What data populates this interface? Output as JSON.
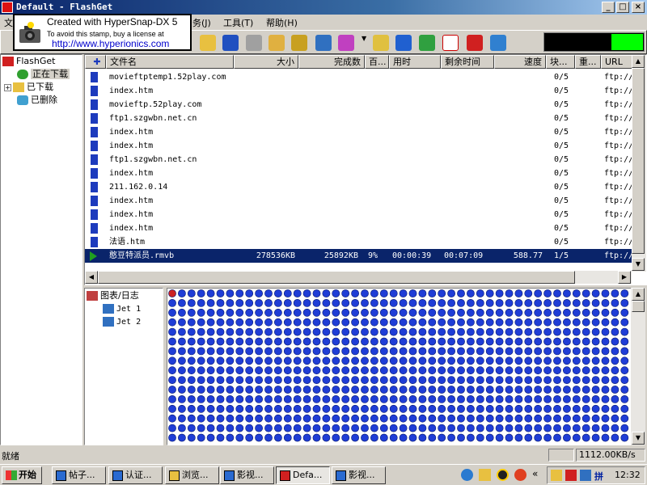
{
  "window": {
    "title": "Default - FlashGet"
  },
  "menu": {
    "visible_tail": "务(J)",
    "tools": "工具(T)",
    "help": "帮助(H)",
    "left_fragment": "文"
  },
  "stamp": {
    "line1": "Created with HyperSnap-DX 5",
    "line2": "To avoid this stamp, buy a license at",
    "line3": "http://www.hyperionics.com"
  },
  "tree": {
    "root": "FlashGet",
    "items": [
      {
        "label": "正在下载",
        "selected": true
      },
      {
        "label": "已下载",
        "selected": false
      },
      {
        "label": "已删除",
        "selected": false
      }
    ]
  },
  "list": {
    "columns": [
      "文件名",
      "大小",
      "完成数",
      "百...",
      "用时",
      "剩余时间",
      "速度",
      "块...",
      "重...",
      "URL"
    ],
    "rows": [
      {
        "name": "movieftptemp1.52play.com",
        "size": "",
        "done": "",
        "pct": "",
        "elapsed": "",
        "remaining": "",
        "speed": "",
        "blocks": "0/5",
        "retry": "",
        "url": "ftp://",
        "selected": false
      },
      {
        "name": "index.htm",
        "size": "",
        "done": "",
        "pct": "",
        "elapsed": "",
        "remaining": "",
        "speed": "",
        "blocks": "0/5",
        "retry": "",
        "url": "ftp://",
        "selected": false
      },
      {
        "name": "movieftp.52play.com",
        "size": "",
        "done": "",
        "pct": "",
        "elapsed": "",
        "remaining": "",
        "speed": "",
        "blocks": "0/5",
        "retry": "",
        "url": "ftp://",
        "selected": false
      },
      {
        "name": "ftp1.szgwbn.net.cn",
        "size": "",
        "done": "",
        "pct": "",
        "elapsed": "",
        "remaining": "",
        "speed": "",
        "blocks": "0/5",
        "retry": "",
        "url": "ftp://",
        "selected": false
      },
      {
        "name": "index.htm",
        "size": "",
        "done": "",
        "pct": "",
        "elapsed": "",
        "remaining": "",
        "speed": "",
        "blocks": "0/5",
        "retry": "",
        "url": "ftp://",
        "selected": false
      },
      {
        "name": "index.htm",
        "size": "",
        "done": "",
        "pct": "",
        "elapsed": "",
        "remaining": "",
        "speed": "",
        "blocks": "0/5",
        "retry": "",
        "url": "ftp://",
        "selected": false
      },
      {
        "name": "ftp1.szgwbn.net.cn",
        "size": "",
        "done": "",
        "pct": "",
        "elapsed": "",
        "remaining": "",
        "speed": "",
        "blocks": "0/5",
        "retry": "",
        "url": "ftp://",
        "selected": false
      },
      {
        "name": "index.htm",
        "size": "",
        "done": "",
        "pct": "",
        "elapsed": "",
        "remaining": "",
        "speed": "",
        "blocks": "0/5",
        "retry": "",
        "url": "ftp://",
        "selected": false
      },
      {
        "name": "211.162.0.14",
        "size": "",
        "done": "",
        "pct": "",
        "elapsed": "",
        "remaining": "",
        "speed": "",
        "blocks": "0/5",
        "retry": "",
        "url": "ftp://",
        "selected": false
      },
      {
        "name": "index.htm",
        "size": "",
        "done": "",
        "pct": "",
        "elapsed": "",
        "remaining": "",
        "speed": "",
        "blocks": "0/5",
        "retry": "",
        "url": "ftp://",
        "selected": false
      },
      {
        "name": "index.htm",
        "size": "",
        "done": "",
        "pct": "",
        "elapsed": "",
        "remaining": "",
        "speed": "",
        "blocks": "0/5",
        "retry": "",
        "url": "ftp://",
        "selected": false
      },
      {
        "name": "index.htm",
        "size": "",
        "done": "",
        "pct": "",
        "elapsed": "",
        "remaining": "",
        "speed": "",
        "blocks": "0/5",
        "retry": "",
        "url": "ftp://",
        "selected": false
      },
      {
        "name": "法语.htm",
        "size": "",
        "done": "",
        "pct": "",
        "elapsed": "",
        "remaining": "",
        "speed": "",
        "blocks": "0/5",
        "retry": "",
        "url": "ftp://",
        "selected": false
      },
      {
        "name": "憨豆特派员.rmvb",
        "size": "278536KB",
        "done": "25892KB",
        "pct": "9%",
        "elapsed": "00:00:39",
        "remaining": "00:07:09",
        "speed": "588.77",
        "blocks": "1/5",
        "retry": "",
        "url": "ftp://",
        "selected": true
      }
    ]
  },
  "graph_tree": {
    "root": "图表/日志",
    "items": [
      "Jet 1",
      "Jet 2"
    ]
  },
  "status": {
    "left": "就绪",
    "speed": "1112.00KB/s"
  },
  "taskbar": {
    "start": "开始",
    "tasks": [
      "帖子...",
      "认证...",
      "浏览...",
      "影视...",
      "Defa...",
      "影视..."
    ],
    "ime": "拼",
    "clock": "12:32"
  },
  "colors": {
    "selection": "#0a246a",
    "titlebar": "#0a246a",
    "chrome": "#d4d0c8",
    "grid_block": "#1f3dd6",
    "grid_done": "#cc2222",
    "speed_meter": "#00ff00"
  },
  "grid": {
    "rows": 16,
    "cols": 48,
    "completed_blocks": 1
  }
}
